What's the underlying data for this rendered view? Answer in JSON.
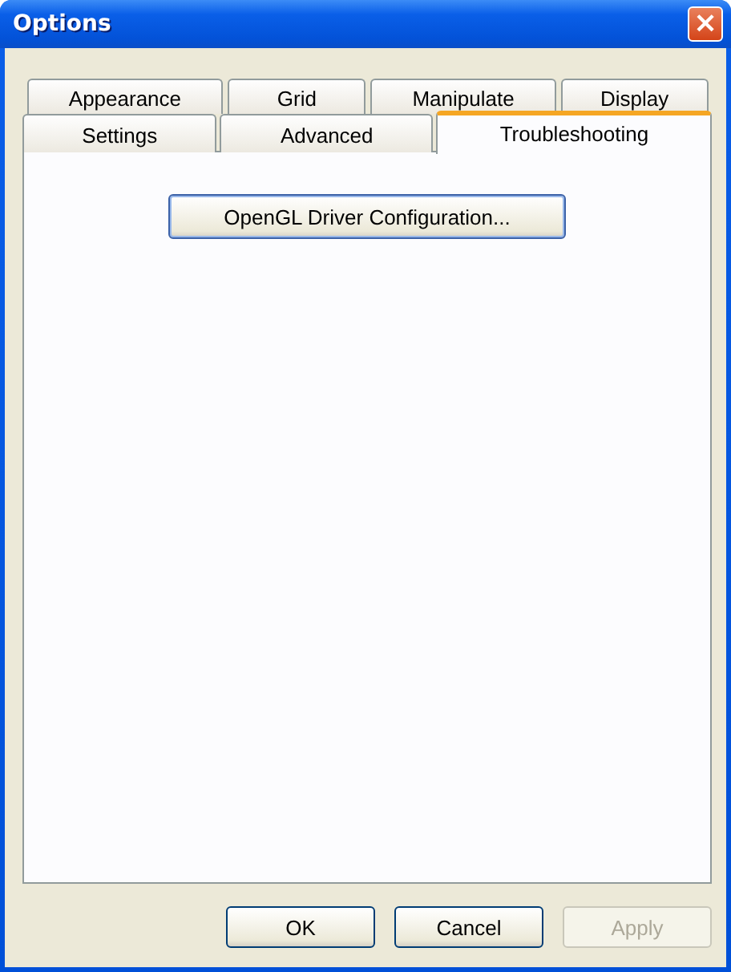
{
  "window": {
    "title": "Options",
    "close": "×"
  },
  "tab_rows": [
    [
      {
        "label": "Appearance",
        "selected": false
      },
      {
        "label": "Grid",
        "selected": false
      },
      {
        "label": "Manipulate",
        "selected": false
      },
      {
        "label": "Display",
        "selected": false
      }
    ],
    [
      {
        "label": "Settings",
        "selected": false
      },
      {
        "label": "Advanced",
        "selected": false
      },
      {
        "label": "Troubleshooting",
        "selected": true
      }
    ]
  ],
  "panel": {
    "buttons": [
      {
        "label": "OpenGL Driver Configuration...",
        "disabled": false
      }
    ]
  },
  "buttons": [
    {
      "label": "OK",
      "disabled": false
    },
    {
      "label": "Cancel",
      "disabled": false
    },
    {
      "label": "Apply",
      "disabled": true
    }
  ]
}
